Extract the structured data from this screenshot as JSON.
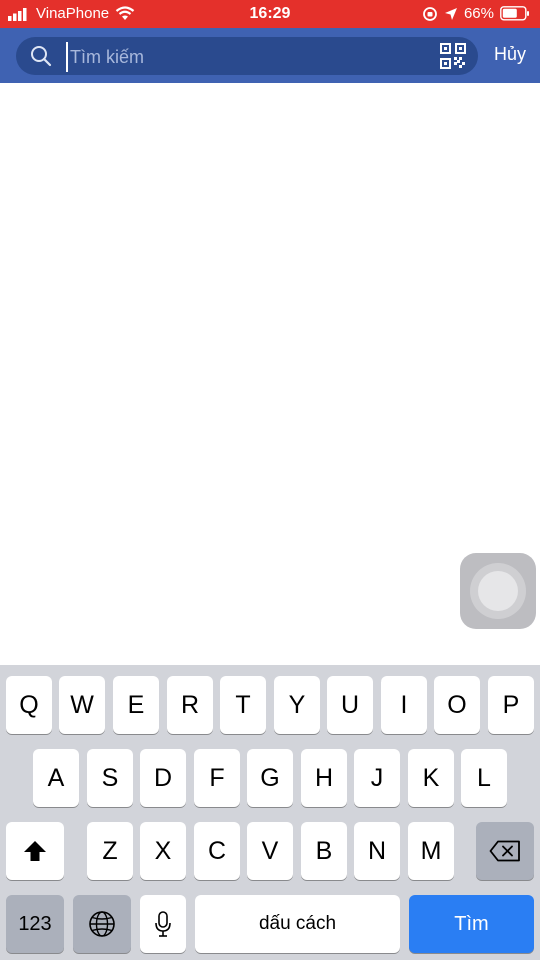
{
  "status_bar": {
    "carrier": "VinaPhone",
    "time": "16:29",
    "battery": "66%"
  },
  "search": {
    "placeholder": "Tìm kiếm",
    "cancel_label": "Hủy"
  },
  "keyboard": {
    "row1": [
      "Q",
      "W",
      "E",
      "R",
      "T",
      "Y",
      "U",
      "I",
      "O",
      "P"
    ],
    "row2": [
      "A",
      "S",
      "D",
      "F",
      "G",
      "H",
      "J",
      "K",
      "L"
    ],
    "row3": [
      "Z",
      "X",
      "C",
      "V",
      "B",
      "N",
      "M"
    ],
    "numbers_label": "123",
    "space_label": "dấu cách",
    "return_label": "Tìm"
  }
}
